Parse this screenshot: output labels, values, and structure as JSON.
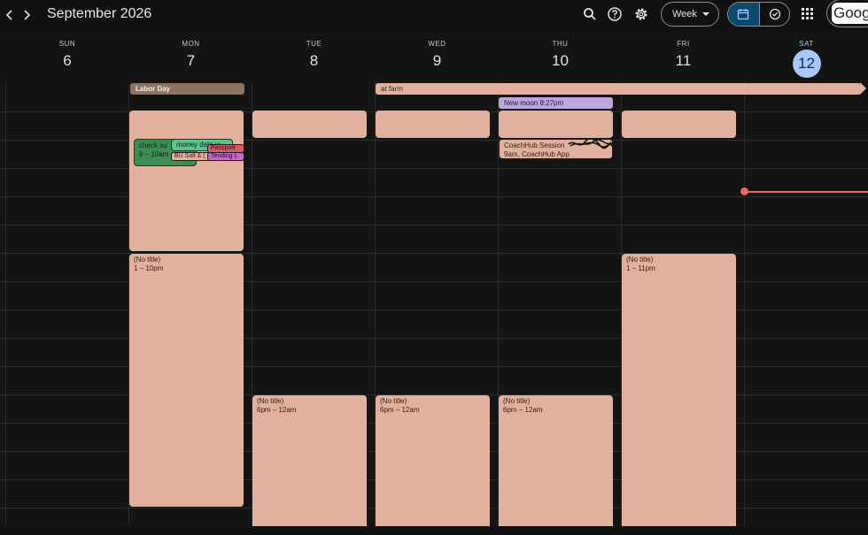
{
  "header": {
    "prev_icon": "chevron-left",
    "next_icon": "chevron-right",
    "month_title": "September 2026",
    "search_icon": "search",
    "help_icon": "help-circle",
    "settings_icon": "gear",
    "view_label": "Week",
    "calendar_icon": "calendar",
    "tasks_icon": "check-circle",
    "apps_icon": "grid-dots",
    "account_label": "Goog"
  },
  "days": [
    {
      "name": "SUN",
      "number": "6"
    },
    {
      "name": "MON",
      "number": "7"
    },
    {
      "name": "TUE",
      "number": "8"
    },
    {
      "name": "WED",
      "number": "9"
    },
    {
      "name": "THU",
      "number": "10"
    },
    {
      "name": "FRI",
      "number": "11"
    },
    {
      "name": "SAT",
      "number": "12",
      "today": true
    }
  ],
  "all_day_events": {
    "labor_day": "Labor Day",
    "at_farm": "at farm"
  },
  "events": {
    "new_moon": "New moon 8:27pm",
    "check_sum_title": "check su",
    "check_sum_time": "9 – 10am",
    "money_date": "money date w",
    "bu_salt": "BU Salt & (",
    "passport": "Passport",
    "tending": "Tending L",
    "coachhub_title": "CoachHub Session",
    "coachhub_time": "9am, CoachHub App",
    "mon_notitle_title": "(No title)",
    "mon_notitle_time": "1 – 10pm",
    "fri_notitle_title": "(No title)",
    "fri_notitle_time": "1 – 11pm",
    "tue_notitle_title": "(No title)",
    "tue_notitle_time": "6pm – 12am",
    "wed_notitle_title": "(No title)",
    "wed_notitle_time": "6pm – 12am",
    "thu_notitle_title": "(No title)",
    "thu_notitle_time": "6pm – 12am"
  },
  "colors": {
    "background": "#141414",
    "event_peach": "#e2b19b",
    "labor_day": "#8d7462",
    "new_moon": "#b9a7dd",
    "green_event": "#3c8e56",
    "today_badge": "#a8c7fa",
    "now_line": "#ee675c"
  }
}
